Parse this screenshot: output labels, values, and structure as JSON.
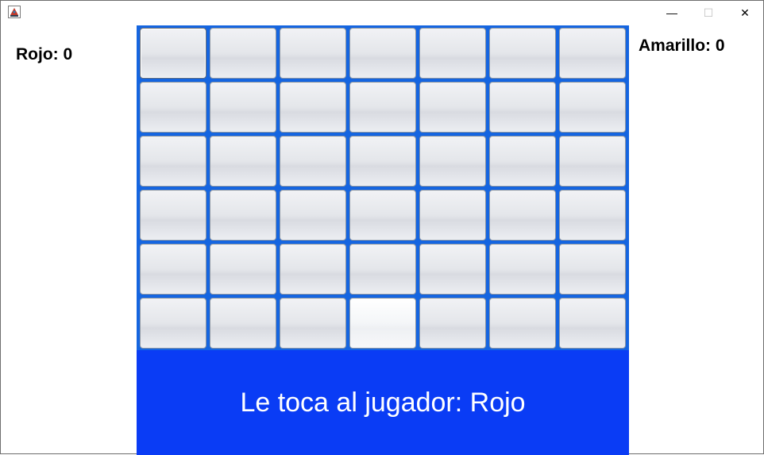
{
  "window": {
    "icon": "java-app-icon",
    "controls": {
      "minimize": "—",
      "maximize": "☐",
      "close": "✕"
    }
  },
  "scores": {
    "rojo": "Rojo: 0",
    "amarillo": "Amarillo: 0"
  },
  "board": {
    "rows": 6,
    "columns": 7,
    "focused_cell": [
      0,
      0
    ],
    "hover_cell": [
      5,
      3
    ],
    "color": "#1565e0"
  },
  "turn": {
    "text": "Le toca al jugador: Rojo",
    "color": "#0a3cf5"
  }
}
